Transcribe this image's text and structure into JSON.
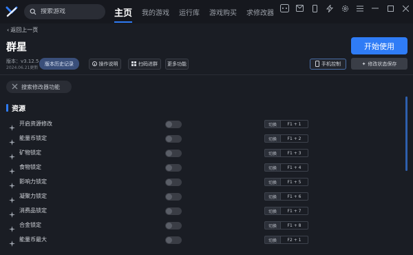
{
  "topbar": {
    "search_placeholder": "搜索游戏",
    "nav": [
      {
        "label": "主页",
        "active": true
      },
      {
        "label": "我的游戏",
        "active": false
      },
      {
        "label": "运行库",
        "active": false
      },
      {
        "label": "游戏购买",
        "active": false
      },
      {
        "label": "求修改器",
        "active": false
      }
    ],
    "window_icons": [
      "gamepad-icon",
      "mail-icon",
      "phone-icon",
      "bolt-icon",
      "settings-icon",
      "menu-icon",
      "minimize-icon",
      "maximize-icon",
      "close-icon"
    ]
  },
  "page": {
    "back_label": "返回上一页",
    "title": "群星",
    "version": "版本：v3.12.5",
    "date": "2024.06.21更新",
    "buttons": {
      "history": "版本历史记录",
      "operation": "操作说明",
      "scan": "扫码进群",
      "more": "更多功能",
      "start": "开始使用",
      "phone": "手机控制",
      "save": "修改状态保存"
    },
    "mod_search_placeholder": "搜索修改器功能",
    "section_title": "资源"
  },
  "rows": [
    {
      "label": "开启资源修改",
      "switch": "切换",
      "key": "F1 + 1",
      "enabled": false
    },
    {
      "label": "能量币锁定",
      "switch": "切换",
      "key": "F1 + 2",
      "enabled": false
    },
    {
      "label": "矿物锁定",
      "switch": "切换",
      "key": "F1 + 3",
      "enabled": false
    },
    {
      "label": "食物锁定",
      "switch": "切换",
      "key": "F1 + 4",
      "enabled": false
    },
    {
      "label": "影响力锁定",
      "switch": "切换",
      "key": "F1 + 5",
      "enabled": false
    },
    {
      "label": "凝聚力锁定",
      "switch": "切换",
      "key": "F1 + 6",
      "enabled": false
    },
    {
      "label": "消费品锁定",
      "switch": "切换",
      "key": "F1 + 7",
      "enabled": false
    },
    {
      "label": "合金锁定",
      "switch": "切换",
      "key": "F1 + 8",
      "enabled": false
    },
    {
      "label": "能量币最大",
      "switch": "切换",
      "key": "F2 + 1",
      "enabled": false
    }
  ],
  "colors": {
    "accent": "#2f7cf6",
    "background": "#1a1d24"
  }
}
